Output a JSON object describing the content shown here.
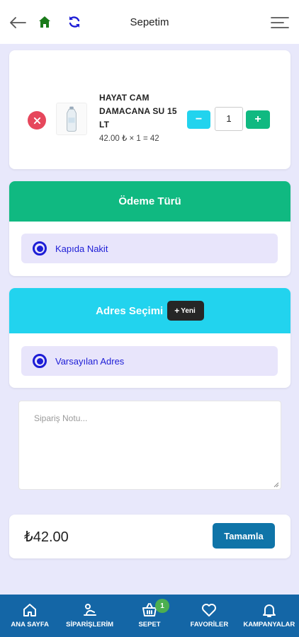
{
  "header": {
    "title": "Sepetim",
    "back_icon": "arrow-left-icon",
    "home_icon": "home-icon",
    "refresh_icon": "refresh-icon",
    "menu_icon": "menu-icon"
  },
  "cart": {
    "items": [
      {
        "name": "HAYAT CAM DAMACANA SU 15 LT",
        "price_line": "42.00 ₺ × 1 = 42",
        "quantity": "1",
        "minus_label": "−",
        "plus_label": "+"
      }
    ]
  },
  "payment": {
    "title": "Ödeme Türü",
    "selected_option": "Kapıda Nakit"
  },
  "address": {
    "title": "Adres Seçimi",
    "new_button": "Yeni",
    "selected_option": "Varsayılan Adres"
  },
  "note": {
    "placeholder": "Sipariş Notu..."
  },
  "summary": {
    "total": "₺42.00",
    "complete_button": "Tamamla"
  },
  "bottom_nav": {
    "items": [
      {
        "label": "ANA SAYFA",
        "icon": "home-icon"
      },
      {
        "label": "SİPARİŞLERİM",
        "icon": "orders-icon"
      },
      {
        "label": "SEPET",
        "icon": "basket-icon",
        "badge": "1"
      },
      {
        "label": "FAVORİLER",
        "icon": "heart-icon"
      },
      {
        "label": "KAMPANYALAR",
        "icon": "bell-icon"
      }
    ]
  },
  "colors": {
    "payment_header": "#10b981",
    "address_header": "#22d3ee",
    "nav_bg": "#1466a6",
    "accent_radio": "#1d1dd6",
    "remove": "#e6475c"
  }
}
